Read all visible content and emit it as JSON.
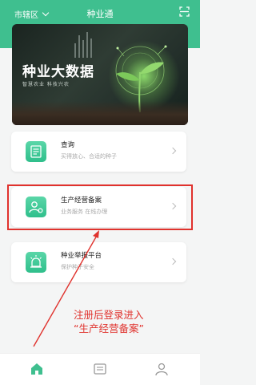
{
  "header": {
    "region": "市辖区",
    "title": "种业通"
  },
  "banner": {
    "title": "种业大数据",
    "subtitle": "智慧农业 科技兴农"
  },
  "cards": [
    {
      "title": "查询",
      "subtitle": "买得放心、合适的种子"
    },
    {
      "title": "生产经营备案",
      "subtitle": "业务服务 在线办理"
    },
    {
      "title": "种业举报平台",
      "subtitle": "保护种子安全"
    }
  ],
  "annotation": {
    "line1": "注册后登录进入",
    "line2": "“生产经营备案”"
  },
  "colors": {
    "brand": "#3fbf8f",
    "highlight": "#e0322d"
  },
  "icons": [
    "chevron-down-icon",
    "scan-icon",
    "document-icon",
    "user-settings-icon",
    "alarm-icon",
    "chevron-right-icon",
    "home-icon",
    "message-icon",
    "person-icon"
  ]
}
